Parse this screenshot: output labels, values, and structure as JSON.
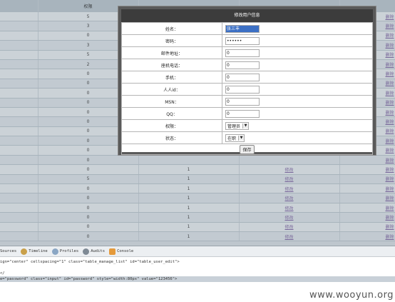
{
  "table": {
    "header": [
      "",
      "权限",
      "",
      "",
      ""
    ],
    "rows": [
      [
        "",
        "5",
        "",
        "",
        "删除"
      ],
      [
        "",
        "3",
        "",
        "",
        "删除"
      ],
      [
        "",
        "0",
        "",
        "",
        "删除"
      ],
      [
        "",
        "3",
        "",
        "",
        "删除"
      ],
      [
        "",
        "5",
        "",
        "",
        "删除"
      ],
      [
        "",
        "2",
        "",
        "",
        "删除"
      ],
      [
        "",
        "0",
        "",
        "",
        "删除"
      ],
      [
        "",
        "0",
        "",
        "",
        "删除"
      ],
      [
        "",
        "0",
        "",
        "",
        "删除"
      ],
      [
        "",
        "0",
        "",
        "",
        "删除"
      ],
      [
        "",
        "0",
        "",
        "",
        "删除"
      ],
      [
        "",
        "0",
        "",
        "",
        "删除"
      ],
      [
        "",
        "0",
        "",
        "",
        "删除"
      ],
      [
        "",
        "0",
        "",
        "",
        "删除"
      ],
      [
        "",
        "0",
        "",
        "",
        "删除"
      ],
      [
        "",
        "0",
        "",
        "",
        "删除"
      ],
      [
        "",
        "0",
        "1",
        "修改",
        "删除"
      ],
      [
        "",
        "5",
        "1",
        "修改",
        "删除"
      ],
      [
        "",
        "0",
        "1",
        "修改",
        "删除"
      ],
      [
        "",
        "0",
        "1",
        "修改",
        "删除"
      ],
      [
        "",
        "0",
        "1",
        "修改",
        "删除"
      ],
      [
        "",
        "0",
        "1",
        "修改",
        "删除"
      ],
      [
        "",
        "0",
        "1",
        "修改",
        "删除"
      ],
      [
        "",
        "0",
        "1",
        "修改",
        "删除"
      ]
    ]
  },
  "modal": {
    "title": "修改用户信息",
    "fields": [
      {
        "label": "姓名：",
        "value": "张三丰",
        "selected": true
      },
      {
        "label": "密码：",
        "value": "••••••"
      },
      {
        "label": "邮件地址：",
        "value": "0"
      },
      {
        "label": "座机电话：",
        "value": "0"
      },
      {
        "label": "手机：",
        "value": "0"
      },
      {
        "label": "人人id：",
        "value": "0"
      },
      {
        "label": "MSN：",
        "value": "0"
      },
      {
        "label": "QQ：",
        "value": "0"
      }
    ],
    "role_label": "权限：",
    "role_value": "管理员",
    "status_label": "状态：",
    "status_value": "在职",
    "save_label": "保存"
  },
  "devtools": {
    "tabs": [
      "Sources",
      "Timeline",
      "Profiles",
      "Audits",
      "Console"
    ],
    "line1": "ign=\"center\" cellspacing=\"1\" class=\"table_manage_list\" id=\"table_user_edit\">",
    "line2": "</",
    "line3": "r>",
    "line4": "e=\"password\" class=\"input\" id=\"password\" style=\"width:80px\" value=\"123456\">"
  },
  "watermark": "www.wooyun.org",
  "colors": {
    "title_bar": "#3c3c3c",
    "selection": "#3b6fc4",
    "link": "#7a5fa0"
  }
}
